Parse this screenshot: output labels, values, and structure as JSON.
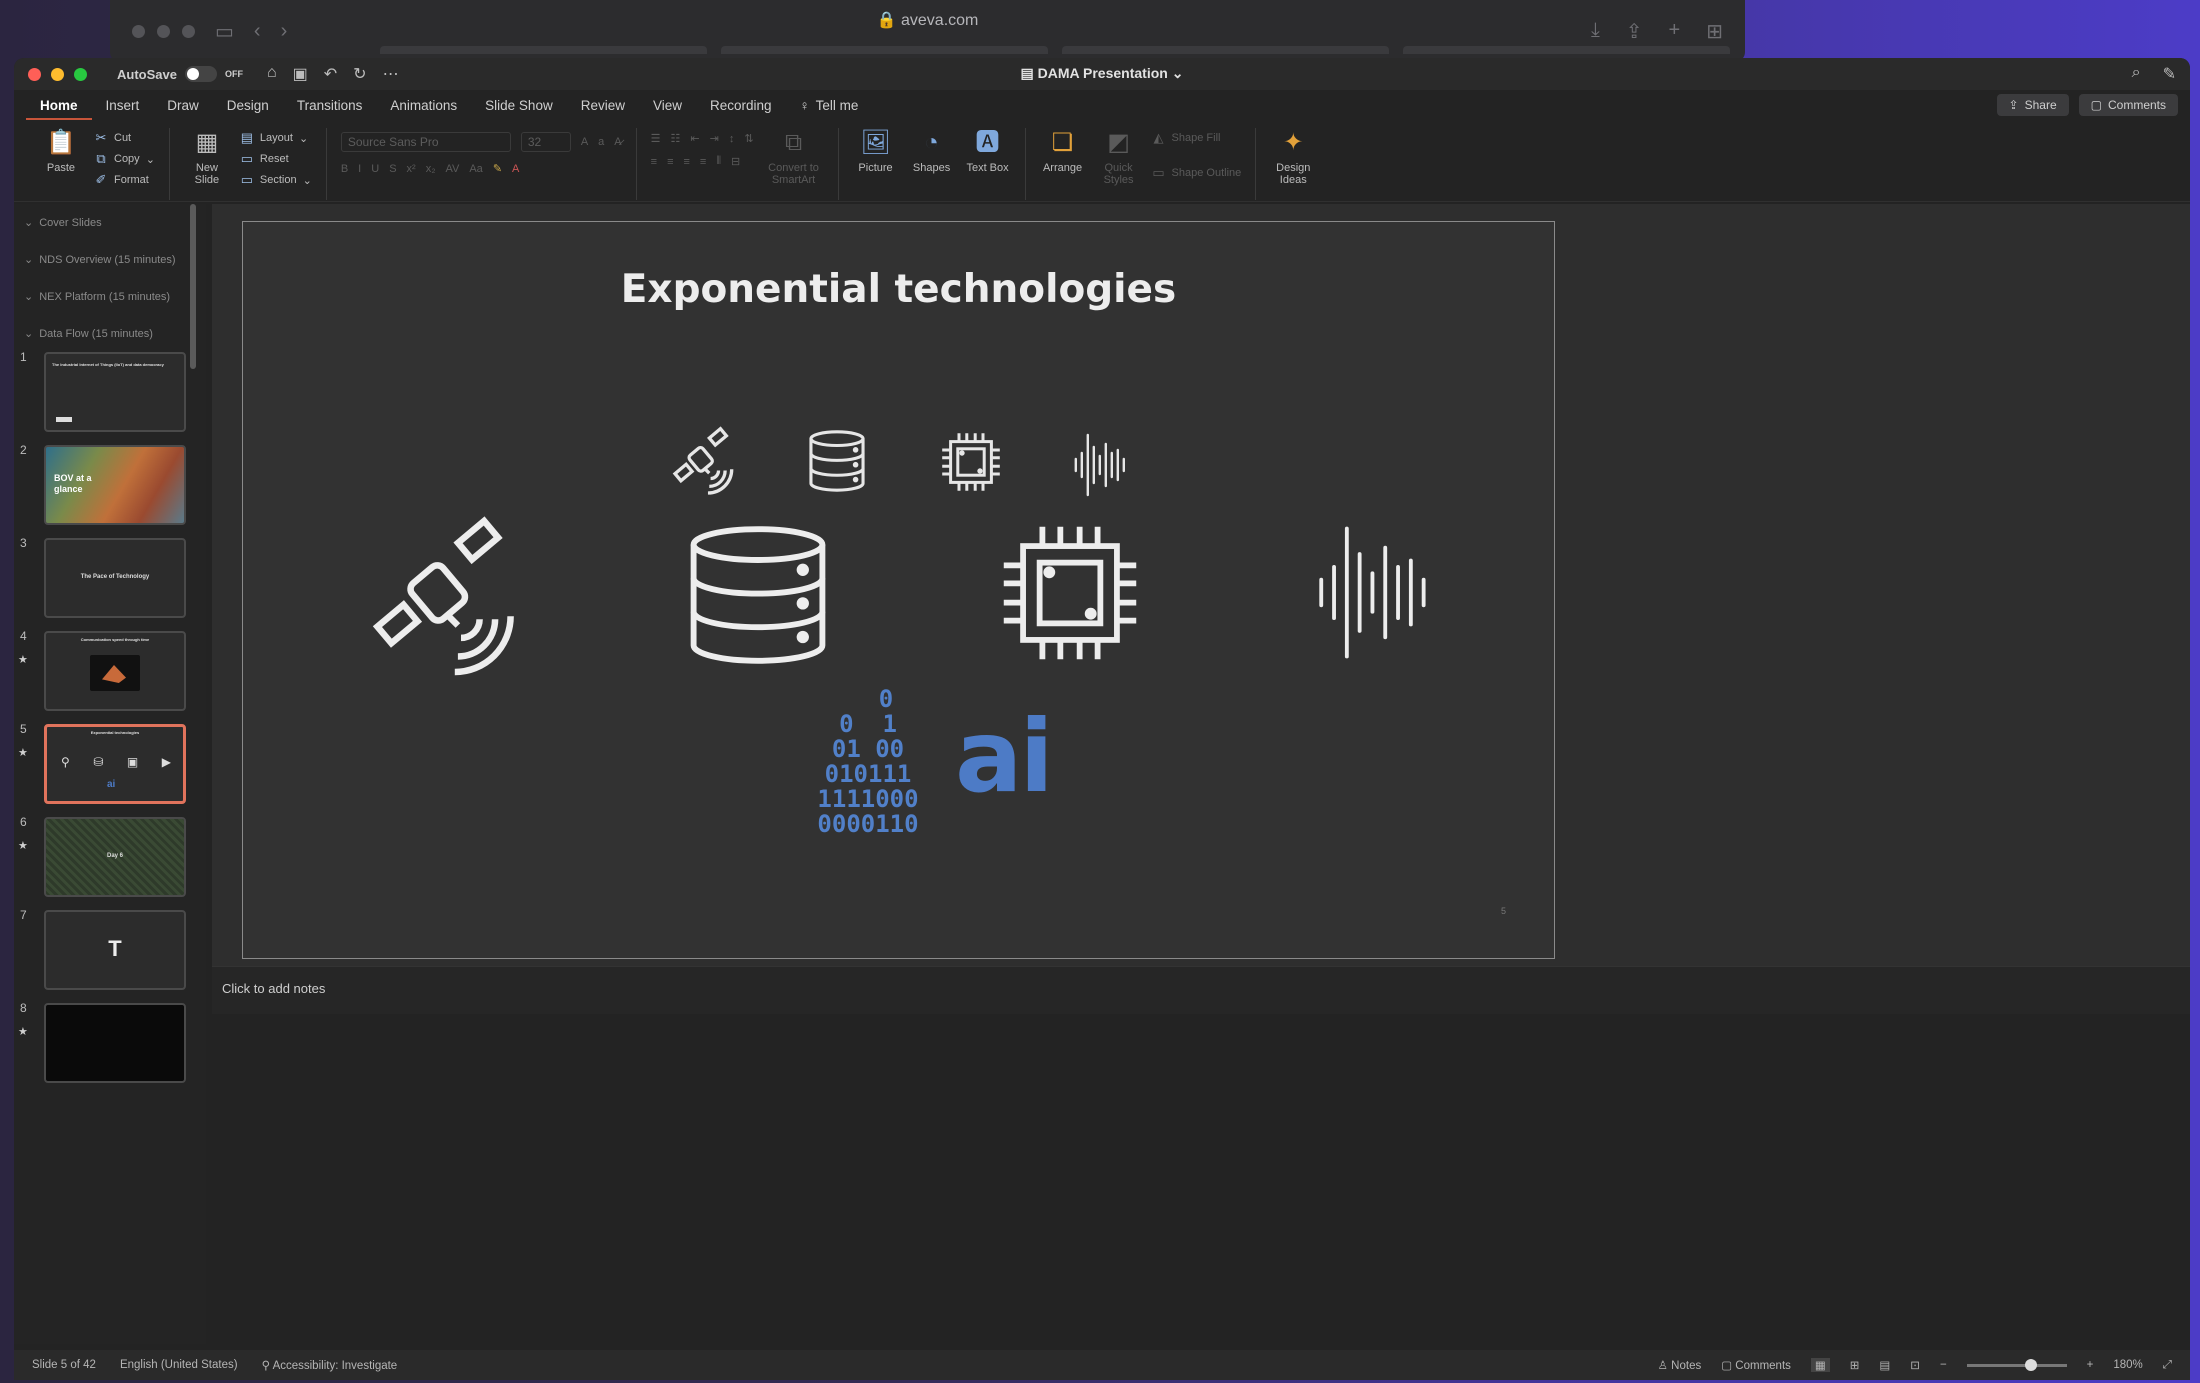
{
  "browser": {
    "url": "aveva.com"
  },
  "app": {
    "autosave_label": "AutoSave",
    "autosave_state": "OFF",
    "doc_title": "DAMA Presentation"
  },
  "tabs": [
    "Home",
    "Insert",
    "Draw",
    "Design",
    "Transitions",
    "Animations",
    "Slide Show",
    "Review",
    "View",
    "Recording"
  ],
  "tell_me": "Tell me",
  "share_label": "Share",
  "comments_label": "Comments",
  "ribbon": {
    "paste": "Paste",
    "cut": "Cut",
    "copy": "Copy",
    "format": "Format",
    "new_slide": "New Slide",
    "layout": "Layout",
    "reset": "Reset",
    "section": "Section",
    "font_name": "Source Sans Pro",
    "font_size": "32",
    "convert": "Convert to SmartArt",
    "picture": "Picture",
    "shapes": "Shapes",
    "textbox": "Text Box",
    "arrange": "Arrange",
    "quick_styles": "Quick Styles",
    "shape_fill": "Shape Fill",
    "shape_outline": "Shape Outline",
    "design_ideas": "Design Ideas"
  },
  "sidebar": {
    "sections": [
      "Cover Slides",
      "NDS Overview (15 minutes)",
      "NEX Platform (15 minutes)",
      "Data Flow (15 minutes)"
    ],
    "slides": [
      {
        "num": "1",
        "text": "The Industrial Internet of Things (IIoT) and data democracy"
      },
      {
        "num": "2",
        "text": "BOV at a glance"
      },
      {
        "num": "3",
        "text": "The Pace of Technology"
      },
      {
        "num": "4",
        "text": "Communication speed through time"
      },
      {
        "num": "5",
        "text": "Exponential technologies"
      },
      {
        "num": "6",
        "text": "Day 6"
      },
      {
        "num": "7",
        "text": ""
      },
      {
        "num": "8",
        "text": ""
      }
    ]
  },
  "slide": {
    "title": "Exponential technologies",
    "binary_lines": [
      "0",
      "0  1",
      "01 00",
      "010111",
      "1111000",
      "0000110"
    ],
    "ai_text": "ai",
    "page_num": "5"
  },
  "notes_placeholder": "Click to add notes",
  "status": {
    "slide_pos": "Slide 5 of 42",
    "language": "English (United States)",
    "accessibility": "Accessibility: Investigate",
    "notes": "Notes",
    "comments": "Comments",
    "zoom": "180%"
  },
  "colors": {
    "accent": "#c8553a",
    "binary_blue": "#5180c9",
    "ai_blue": "#4d7bc6"
  }
}
